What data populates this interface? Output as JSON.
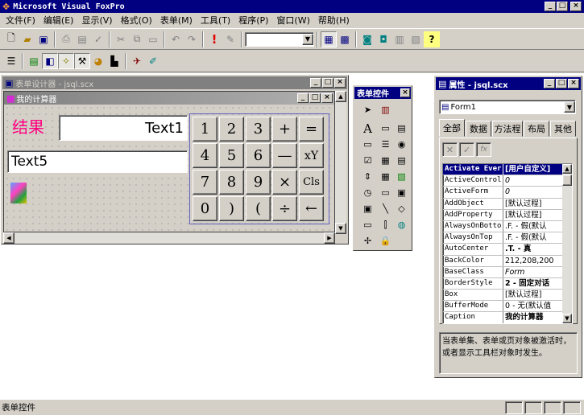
{
  "app": {
    "title": "Microsoft Visual FoxPro",
    "icon": "fox-icon"
  },
  "title_buttons": [
    "_",
    "□",
    "×"
  ],
  "menu": [
    "文件(F)",
    "编辑(E)",
    "显示(V)",
    "格式(O)",
    "表单(M)",
    "工具(T)",
    "程序(P)",
    "窗口(W)",
    "帮助(H)"
  ],
  "toolbar": {
    "combo_value": ""
  },
  "designer": {
    "title": "表单设计器 - jsql.scx",
    "form_title": "我的计算器",
    "result_label": "结果",
    "text1": "Text1",
    "text5": "Text5",
    "calc_buttons": [
      "1",
      "2",
      "3",
      "+",
      "=",
      "4",
      "5",
      "6",
      "—",
      "xY",
      "7",
      "8",
      "9",
      "×",
      "Cls",
      "0",
      ")",
      "(",
      "÷",
      "←"
    ]
  },
  "controls": {
    "title": "表单控件"
  },
  "props": {
    "title": "属性 - jsql.scx",
    "object": "Form1",
    "tabs": [
      "全部",
      "数据",
      "方法程",
      "布局",
      "其他"
    ],
    "rows": [
      {
        "name": "Activate Ever",
        "value": "[用户自定义]"
      },
      {
        "name": "ActiveControl",
        "value": "0"
      },
      {
        "name": "ActiveForm",
        "value": "0"
      },
      {
        "name": "AddObject",
        "value": "[默认过程]"
      },
      {
        "name": "AddProperty",
        "value": "[默认过程]"
      },
      {
        "name": "AlwaysOnBotto",
        "value": ".F. - 假(默认"
      },
      {
        "name": "AlwaysOnTop",
        "value": ".F. - 假(默认"
      },
      {
        "name": "AutoCenter",
        "value": ".T. - 真"
      },
      {
        "name": "BackColor",
        "value": "212,208,200"
      },
      {
        "name": "BaseClass",
        "value": "Form"
      },
      {
        "name": "BorderStyle",
        "value": "2 - 固定对话"
      },
      {
        "name": "Box",
        "value": "[默认过程]"
      },
      {
        "name": "BufferMode",
        "value": "0 - 无(默认值"
      },
      {
        "name": "Caption",
        "value": "我的计算器"
      }
    ],
    "description": "当表单集、表单或页对象被激活时，或者显示工具栏对象时发生。"
  },
  "status": {
    "text": "表单控件"
  },
  "colors": {
    "title_active": "#000080",
    "title_inactive": "#808080",
    "face": "#d4d0c8",
    "result_label": "#ff0080"
  }
}
